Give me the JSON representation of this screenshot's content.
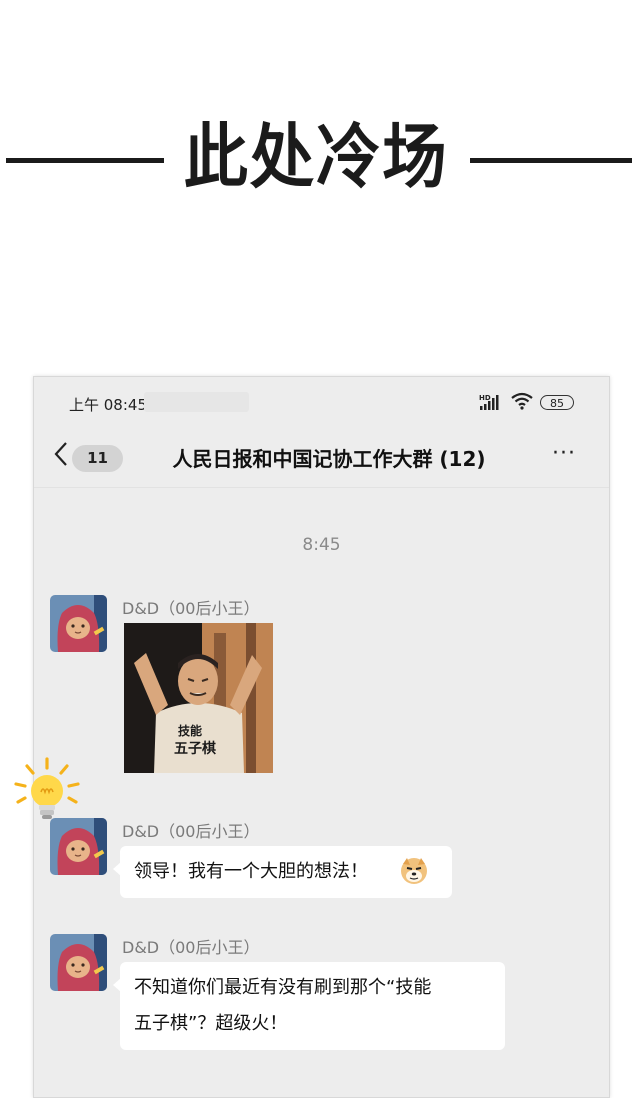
{
  "banner": {
    "title": "此处冷场"
  },
  "status_bar": {
    "time": "上午 08:45",
    "network": "HD",
    "battery": "85"
  },
  "nav": {
    "unread_count": "11",
    "title": "人民日报和中国记协工作大群 (12)",
    "more": "···"
  },
  "chat": {
    "timestamp": "8:45",
    "messages": [
      {
        "sender": "D&D（00后小王）",
        "type": "sticker",
        "sticker_text": [
          "技能",
          "五子棋"
        ]
      },
      {
        "sender": "D&D（00后小王）",
        "type": "text",
        "text": "领导！我有一个大胆的想法！",
        "emoji": "doge-emoji"
      },
      {
        "sender": "D&D（00后小王）",
        "type": "text",
        "lines": [
          "不知道你们最近有没有刷到那个“技能",
          "五子棋”？超级火！"
        ]
      }
    ]
  },
  "colors": {
    "chat_bg": "#ededed",
    "bubble": "#ffffff",
    "banner_text": "#1b1b1b",
    "avatar_hood": "#c2445a"
  }
}
